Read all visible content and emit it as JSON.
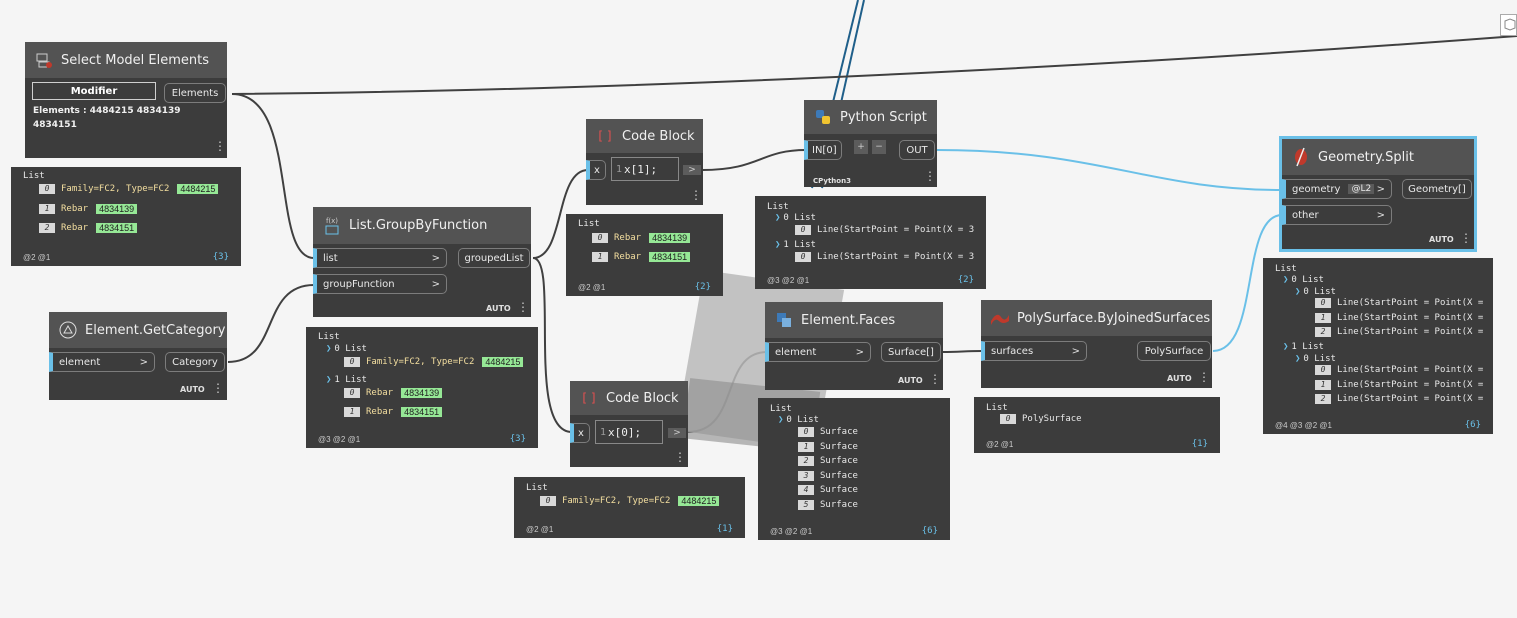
{
  "nodes": {
    "select_model": {
      "title": "Select Model Elements",
      "modifier_label": "Modifier",
      "output": "Elements",
      "info_line1": "Elements : 4484215 4834139",
      "info_line2": "4834151"
    },
    "get_category": {
      "title": "Element.GetCategory",
      "input": "element",
      "output": "Category",
      "lacing": "AUTO"
    },
    "group_by": {
      "title": "List.GroupByFunction",
      "icon_text": "f(x)",
      "input1": "list",
      "input2": "groupFunction",
      "output": "groupedList",
      "lacing": "AUTO"
    },
    "code_block_1": {
      "title": "Code Block",
      "input": "x",
      "line_no": "1",
      "code": "x[1];"
    },
    "code_block_2": {
      "title": "Code Block",
      "input": "x",
      "line_no": "1",
      "code": "x[0];"
    },
    "python": {
      "title": "Python Script",
      "input": "IN[0]",
      "plus": "+",
      "minus": "−",
      "output": "OUT",
      "engine": "CPython3"
    },
    "faces": {
      "title": "Element.Faces",
      "input": "element",
      "output": "Surface[]",
      "lacing": "AUTO"
    },
    "polysurface": {
      "title": "PolySurface.ByJoinedSurfaces",
      "input": "surfaces",
      "output": "PolySurface",
      "lacing": "AUTO"
    },
    "split": {
      "title": "Geometry.Split",
      "input1": "geometry",
      "input1_badge": "@L2",
      "input2": "other",
      "output": "Geometry[]",
      "lacing": "AUTO"
    }
  },
  "watches": {
    "select_model": {
      "root": "List",
      "items": [
        {
          "idx": "0",
          "text": "Family=FC2, Type=FC2",
          "id": "4484215"
        },
        {
          "idx": "1",
          "text": "Rebar",
          "id": "4834139"
        },
        {
          "idx": "2",
          "text": "Rebar",
          "id": "4834151"
        }
      ],
      "levels": "@2 @1",
      "count": "{3}"
    },
    "group_by": {
      "root": "List",
      "g0": "0 List",
      "g0_items": [
        {
          "idx": "0",
          "text": "Family=FC2, Type=FC2",
          "id": "4484215"
        }
      ],
      "g1": "1 List",
      "g1_items": [
        {
          "idx": "0",
          "text": "Rebar",
          "id": "4834139"
        },
        {
          "idx": "1",
          "text": "Rebar",
          "id": "4834151"
        }
      ],
      "levels": "@3 @2 @1",
      "count": "{3}"
    },
    "code_block_1": {
      "root": "List",
      "items": [
        {
          "idx": "0",
          "text": "Rebar",
          "id": "4834139"
        },
        {
          "idx": "1",
          "text": "Rebar",
          "id": "4834151"
        }
      ],
      "levels": "@2 @1",
      "count": "{2}"
    },
    "code_block_2": {
      "root": "List",
      "items": [
        {
          "idx": "0",
          "text": "Family=FC2, Type=FC2",
          "id": "4484215"
        }
      ],
      "levels": "@2 @1",
      "count": "{1}"
    },
    "python": {
      "root": "List",
      "g0": "0 List",
      "g0_line": "Line(StartPoint = Point(X = 3",
      "g1": "1 List",
      "g1_line": "Line(StartPoint = Point(X = 3",
      "levels": "@3 @2 @1",
      "count": "{2}"
    },
    "faces": {
      "root": "List",
      "g0": "0 List",
      "items": [
        "Surface",
        "Surface",
        "Surface",
        "Surface",
        "Surface",
        "Surface"
      ],
      "levels": "@3 @2 @1",
      "count": "{6}"
    },
    "polysurface": {
      "root": "List",
      "item": "PolySurface",
      "levels": "@2 @1",
      "count": "{1}"
    },
    "split": {
      "root": "List",
      "g0": "0 List",
      "g00": "0 List",
      "g1": "1 List",
      "g10": "0 List",
      "line": "Line(StartPoint = Point(X =",
      "levels": "@4 @3 @2 @1",
      "count": "{6}"
    }
  },
  "colors": {
    "canvas": "#f5f5f5",
    "node_body": "#3c3c3c",
    "node_header": "#535353",
    "selection": "#6ac0e8",
    "wire_dark": "#404040",
    "wire_blue": "#6ac0e8",
    "highlight_id": "#96e896"
  }
}
